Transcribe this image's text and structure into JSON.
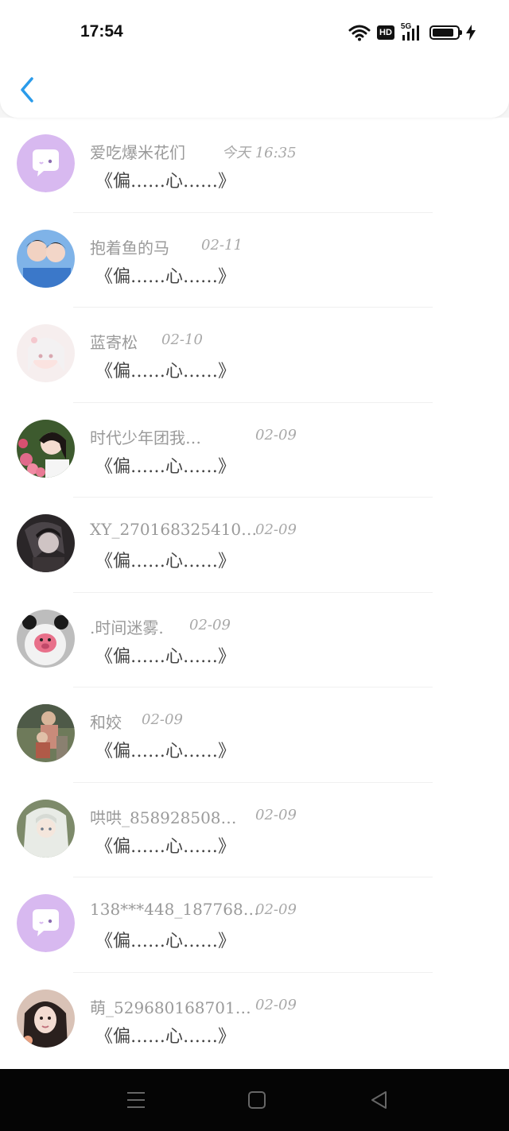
{
  "status_bar": {
    "time": "17:54",
    "network_badge": "HD",
    "network_gen": "5G",
    "battery_level": 0.85
  },
  "header": {
    "back_icon": "chevron-left-icon",
    "accent_color": "#2a9bea"
  },
  "conversations": [
    {
      "name": "爱吃爆米花们",
      "date": "今天 16:35",
      "message": "《偏……心……》",
      "avatar": "chat-bubble"
    },
    {
      "name": "抱着鱼的马",
      "date": "02-11",
      "message": "《偏……心……》",
      "avatar": "photo-couple"
    },
    {
      "name": "蓝寄松",
      "date": "02-10",
      "message": "《偏……心……》",
      "avatar": "photo-anime-pale"
    },
    {
      "name": "时代少年团我…",
      "date": "02-09",
      "message": "《偏……心……》",
      "avatar": "photo-flowers"
    },
    {
      "name": "XY_270168325410…",
      "date": "02-09",
      "message": "《偏……心……》",
      "avatar": "photo-dark-anime"
    },
    {
      "name": ".时间迷雾.",
      "date": "02-09",
      "message": "《偏……心……》",
      "avatar": "photo-panda-bear"
    },
    {
      "name": "和姣",
      "date": "02-09",
      "message": "《偏……心……》",
      "avatar": "photo-family"
    },
    {
      "name": "哄哄_858928508…",
      "date": "02-09",
      "message": "《偏……心……》",
      "avatar": "photo-white-hair"
    },
    {
      "name": "138***448_187768…",
      "date": "02-09",
      "message": "《偏……心……》",
      "avatar": "chat-bubble"
    },
    {
      "name": "萌_529680168701…",
      "date": "02-09",
      "message": "《偏……心……》",
      "avatar": "photo-girl"
    }
  ],
  "navbar": {
    "icons": [
      "menu-icon",
      "home-square-icon",
      "back-triangle-icon"
    ]
  }
}
